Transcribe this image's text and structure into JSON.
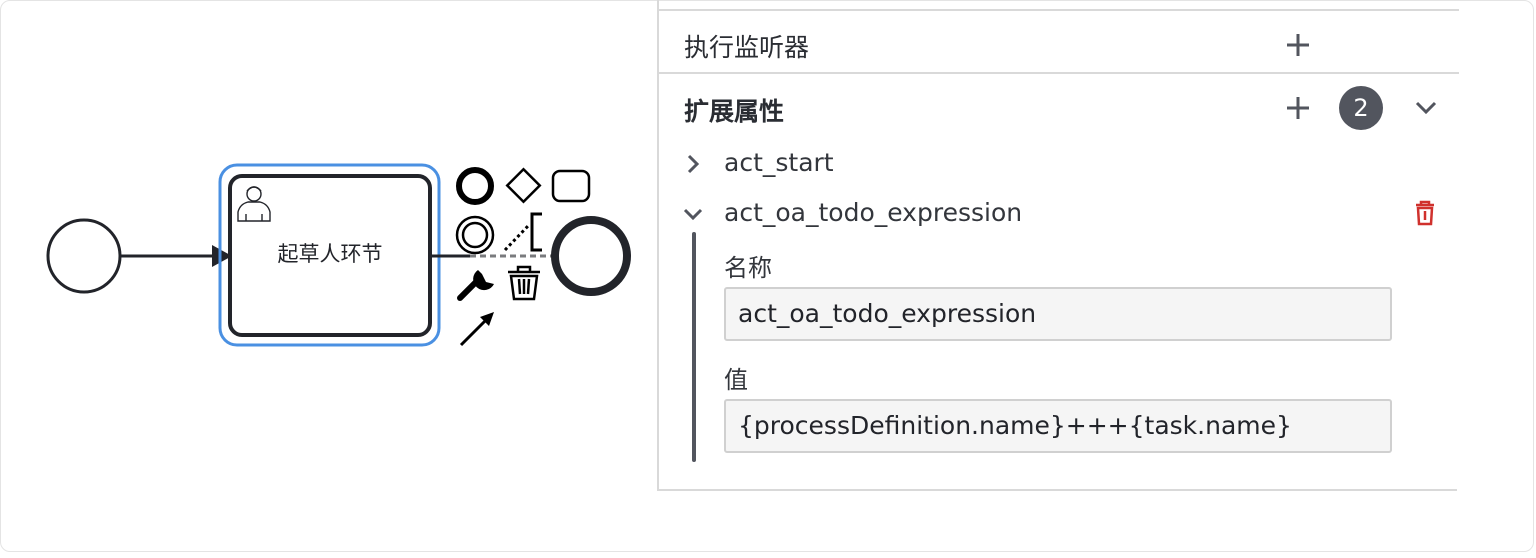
{
  "canvas": {
    "task_name": "起草人环节"
  },
  "panel": {
    "listeners": {
      "title": "执行监听器"
    },
    "extension": {
      "title": "扩展属性",
      "count": "2",
      "items": [
        {
          "name": "act_start",
          "expanded": false
        },
        {
          "name": "act_oa_todo_expression",
          "expanded": true
        }
      ],
      "fields": {
        "name_label": "名称",
        "name_value": "act_oa_todo_expression",
        "value_label": "值",
        "value_value": "{processDefinition.name}+++{task.name}"
      }
    }
  },
  "colors": {
    "selection": "#4a90e2",
    "delete": "#d0312d",
    "badge": "#52555e"
  },
  "icons": [
    "user-icon",
    "plus-icon",
    "chevron-down-icon",
    "chevron-right-icon",
    "trash-icon",
    "wrench-icon",
    "arrow-icon"
  ]
}
